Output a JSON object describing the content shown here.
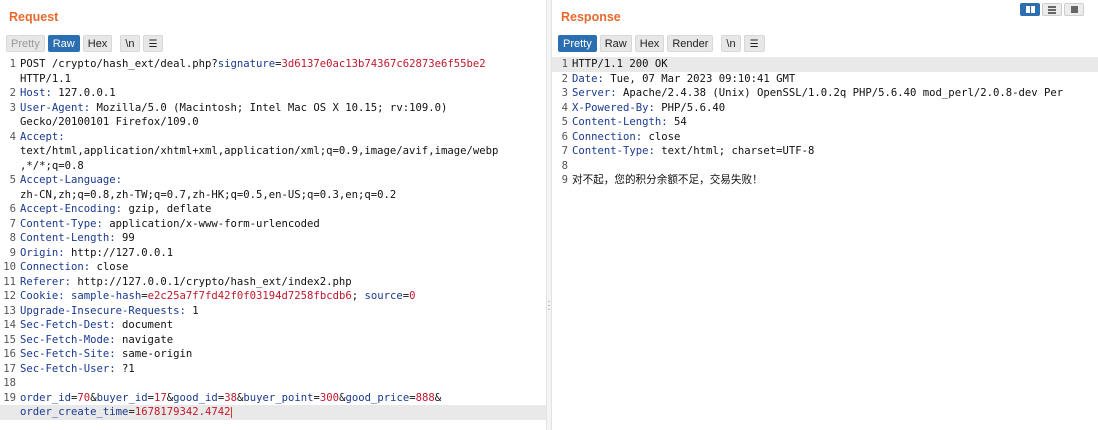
{
  "request": {
    "title": "Request",
    "tabs": [
      "Pretty",
      "Raw",
      "Hex"
    ],
    "newline_btn": "\\n",
    "menu_btn": "☰",
    "lines": [
      {
        "n": "1",
        "parts": [
          {
            "t": "POST /crypto/hash_ext/deal.php?"
          },
          {
            "t": "signature",
            "c": "k"
          },
          {
            "t": "="
          },
          {
            "t": "3d6137e0ac13b74367c62873e6f55be2",
            "c": "v"
          }
        ]
      },
      {
        "n": "",
        "parts": [
          {
            "t": "HTTP/1.1"
          }
        ]
      },
      {
        "n": "2",
        "parts": [
          {
            "t": "Host:",
            "c": "k"
          },
          {
            "t": " 127.0.0.1"
          }
        ]
      },
      {
        "n": "3",
        "parts": [
          {
            "t": "User-Agent:",
            "c": "k"
          },
          {
            "t": " Mozilla/5.0 (Macintosh; Intel Mac OS X 10.15; rv:109.0)"
          }
        ]
      },
      {
        "n": "",
        "parts": [
          {
            "t": "Gecko/20100101 Firefox/109.0"
          }
        ]
      },
      {
        "n": "4",
        "parts": [
          {
            "t": "Accept:",
            "c": "k"
          }
        ]
      },
      {
        "n": "",
        "parts": [
          {
            "t": "text/html,application/xhtml+xml,application/xml;q=0.9,image/avif,image/webp"
          }
        ]
      },
      {
        "n": "",
        "parts": [
          {
            "t": ",*/*;q=0.8"
          }
        ]
      },
      {
        "n": "5",
        "parts": [
          {
            "t": "Accept-Language:",
            "c": "k"
          }
        ]
      },
      {
        "n": "",
        "parts": [
          {
            "t": "zh-CN,zh;q=0.8,zh-TW;q=0.7,zh-HK;q=0.5,en-US;q=0.3,en;q=0.2"
          }
        ]
      },
      {
        "n": "6",
        "parts": [
          {
            "t": "Accept-Encoding:",
            "c": "k"
          },
          {
            "t": " gzip, deflate"
          }
        ]
      },
      {
        "n": "7",
        "parts": [
          {
            "t": "Content-Type:",
            "c": "k"
          },
          {
            "t": " application/x-www-form-urlencoded"
          }
        ]
      },
      {
        "n": "8",
        "parts": [
          {
            "t": "Content-Length:",
            "c": "k"
          },
          {
            "t": " 99"
          }
        ]
      },
      {
        "n": "9",
        "parts": [
          {
            "t": "Origin:",
            "c": "k"
          },
          {
            "t": " http://127.0.0.1"
          }
        ]
      },
      {
        "n": "10",
        "parts": [
          {
            "t": "Connection:",
            "c": "k"
          },
          {
            "t": " close"
          }
        ]
      },
      {
        "n": "11",
        "parts": [
          {
            "t": "Referer:",
            "c": "k"
          },
          {
            "t": " http://127.0.0.1/crypto/hash_ext/index2.php"
          }
        ]
      },
      {
        "n": "12",
        "parts": [
          {
            "t": "Cookie:",
            "c": "k"
          },
          {
            "t": " "
          },
          {
            "t": "sample-hash",
            "c": "k"
          },
          {
            "t": "="
          },
          {
            "t": "e2c25a7f7fd42f0f03194d7258fbcdb6",
            "c": "v"
          },
          {
            "t": "; "
          },
          {
            "t": "source",
            "c": "k"
          },
          {
            "t": "="
          },
          {
            "t": "0",
            "c": "v"
          }
        ]
      },
      {
        "n": "13",
        "parts": [
          {
            "t": "Upgrade-Insecure-Requests:",
            "c": "k"
          },
          {
            "t": " 1"
          }
        ]
      },
      {
        "n": "14",
        "parts": [
          {
            "t": "Sec-Fetch-Dest:",
            "c": "k"
          },
          {
            "t": " document"
          }
        ]
      },
      {
        "n": "15",
        "parts": [
          {
            "t": "Sec-Fetch-Mode:",
            "c": "k"
          },
          {
            "t": " navigate"
          }
        ]
      },
      {
        "n": "16",
        "parts": [
          {
            "t": "Sec-Fetch-Site:",
            "c": "k"
          },
          {
            "t": " same-origin"
          }
        ]
      },
      {
        "n": "17",
        "parts": [
          {
            "t": "Sec-Fetch-User:",
            "c": "k"
          },
          {
            "t": " ?1"
          }
        ]
      },
      {
        "n": "18",
        "parts": []
      },
      {
        "n": "19",
        "parts": [
          {
            "t": "order_id",
            "c": "k"
          },
          {
            "t": "="
          },
          {
            "t": "70",
            "c": "v"
          },
          {
            "t": "&"
          },
          {
            "t": "buyer_id",
            "c": "k"
          },
          {
            "t": "="
          },
          {
            "t": "17",
            "c": "v"
          },
          {
            "t": "&"
          },
          {
            "t": "good_id",
            "c": "k"
          },
          {
            "t": "="
          },
          {
            "t": "38",
            "c": "v"
          },
          {
            "t": "&"
          },
          {
            "t": "buyer_point",
            "c": "k"
          },
          {
            "t": "="
          },
          {
            "t": "300",
            "c": "v"
          },
          {
            "t": "&"
          },
          {
            "t": "good_price",
            "c": "k"
          },
          {
            "t": "="
          },
          {
            "t": "888",
            "c": "v"
          },
          {
            "t": "&"
          }
        ]
      },
      {
        "n": "",
        "hl": true,
        "cursor": true,
        "parts": [
          {
            "t": "order_create_time",
            "c": "k"
          },
          {
            "t": "="
          },
          {
            "t": "1678179342.4742",
            "c": "v"
          }
        ]
      }
    ]
  },
  "response": {
    "title": "Response",
    "tabs": [
      "Pretty",
      "Raw",
      "Hex",
      "Render"
    ],
    "newline_btn": "\\n",
    "menu_btn": "☰",
    "lines": [
      {
        "n": "1",
        "hl": true,
        "parts": [
          {
            "t": "HTTP/1.1 200 OK"
          }
        ]
      },
      {
        "n": "2",
        "parts": [
          {
            "t": "Date:",
            "c": "k"
          },
          {
            "t": " Tue, 07 Mar 2023 09:10:41 GMT"
          }
        ]
      },
      {
        "n": "3",
        "parts": [
          {
            "t": "Server:",
            "c": "k"
          },
          {
            "t": " Apache/2.4.38 (Unix) OpenSSL/1.0.2q PHP/5.6.40 mod_perl/2.0.8-dev Per"
          }
        ]
      },
      {
        "n": "4",
        "parts": [
          {
            "t": "X-Powered-By:",
            "c": "k"
          },
          {
            "t": " PHP/5.6.40"
          }
        ]
      },
      {
        "n": "5",
        "parts": [
          {
            "t": "Content-Length:",
            "c": "k"
          },
          {
            "t": " 54"
          }
        ]
      },
      {
        "n": "6",
        "parts": [
          {
            "t": "Connection:",
            "c": "k"
          },
          {
            "t": " close"
          }
        ]
      },
      {
        "n": "7",
        "parts": [
          {
            "t": "Content-Type:",
            "c": "k"
          },
          {
            "t": " text/html; charset=UTF-8"
          }
        ]
      },
      {
        "n": "8",
        "parts": []
      },
      {
        "n": "9",
        "parts": [
          {
            "t": "对不起，您的积分余额不足，交易失败！"
          }
        ]
      }
    ]
  },
  "colors": {
    "title": "#e8692c",
    "active_tab": "#2c6fb0",
    "header_key": "#1a3a8f",
    "param_value": "#c2182b"
  },
  "icons": {
    "menu": "hamburger-icon",
    "layout_split": "split-view-icon",
    "layout_stacked": "stacked-view-icon",
    "layout_single": "single-view-icon"
  }
}
